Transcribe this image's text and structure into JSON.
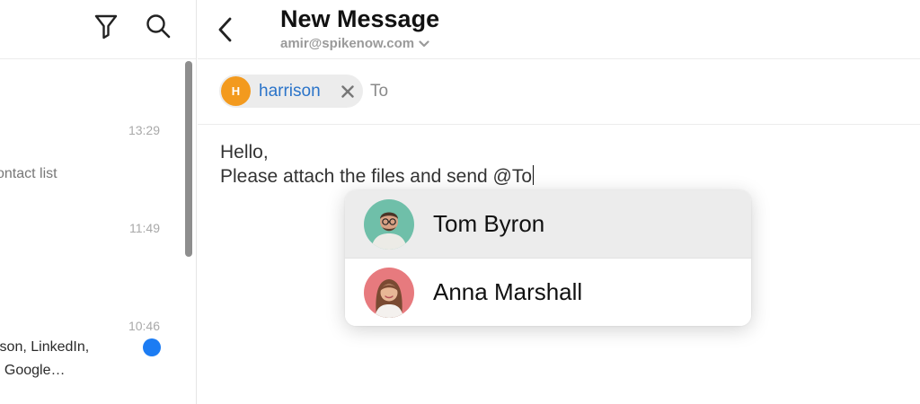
{
  "left_pane": {
    "icons": {
      "filter": "filter-icon",
      "search": "search-icon"
    },
    "threads": [
      {
        "time": "13:29",
        "snippet": "ontact list"
      },
      {
        "time": "11:49",
        "snippet": ""
      },
      {
        "time": "10:46",
        "snippet_line1": "lson, LinkedIn,",
        "snippet_line2": ", Google…",
        "unread": true
      }
    ]
  },
  "compose": {
    "title": "New Message",
    "from": "amir@spikenow.com",
    "recipients": [
      {
        "initial": "H",
        "name": "harrison",
        "avatar_color": "#f39a1e"
      }
    ],
    "to_placeholder": "To",
    "body_line1": "Hello,",
    "body_line2": "Please attach the files and send @To"
  },
  "mention_suggestions": [
    {
      "name": "Tom Byron",
      "avatar_bg": "#6fbfa9",
      "highlighted": true
    },
    {
      "name": "Anna Marshall",
      "avatar_bg": "#e77a7e",
      "highlighted": false
    }
  ],
  "colors": {
    "accent": "#2b74c9",
    "unread_dot": "#1c7cf3",
    "chip_avatar": "#f39a1e"
  }
}
